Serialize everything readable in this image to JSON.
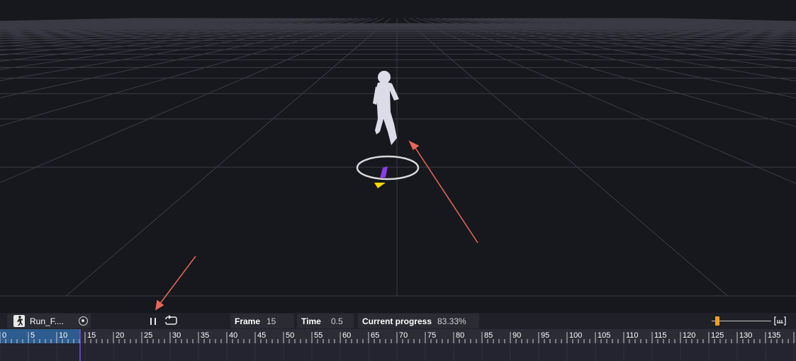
{
  "animation_bar": {
    "clip_name": "Run_F....",
    "frame_label": "Frame",
    "frame_value": "15",
    "time_label": "Time",
    "time_value": "0.5",
    "progress_label": "Current progress",
    "progress_value": "83.33%",
    "icons": [
      "run-clip-icon",
      "target-icon",
      "pause-icon",
      "loop-icon",
      "fit-to-view-icon"
    ]
  },
  "timeline": {
    "ruler_labels": [
      "0",
      "5",
      "10",
      "15",
      "20",
      "25",
      "30",
      "35",
      "40",
      "45",
      "50",
      "55",
      "60",
      "65",
      "70",
      "75",
      "80",
      "85",
      "90",
      "95",
      "100",
      "105",
      "110",
      "115",
      "120",
      "125",
      "130",
      "135",
      "1"
    ],
    "current_frame": 15,
    "zoom_level": 0.06
  },
  "colors": {
    "background": "#17181e",
    "grid": "#3a3b44",
    "playhead": "#7b4fd8",
    "played_range": "#2d5c8e",
    "accent_orange": "#f0a020",
    "annotation_arrow": "#e8665a",
    "gizmo_purple": "#8a3cf0",
    "gizmo_yellow": "#f5d800"
  }
}
